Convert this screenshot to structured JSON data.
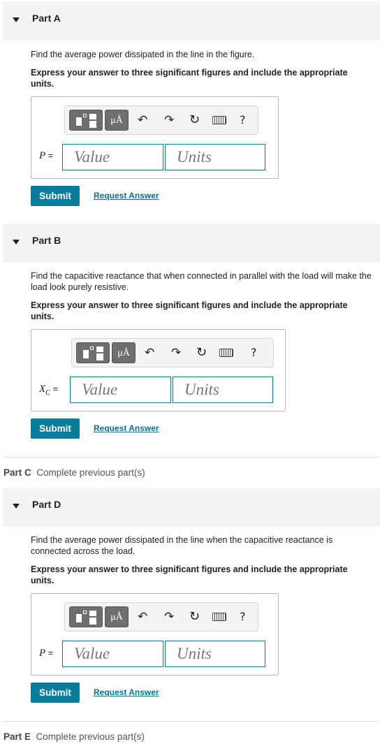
{
  "part_a": {
    "header": "Part A",
    "question": "Find the average power dissipated in the line in the figure.",
    "instruction": "Express your answer to three significant figures and include the appropriate units.",
    "variable": "P",
    "equals": "=",
    "value_placeholder": "Value",
    "units_placeholder": "Units",
    "submit": "Submit",
    "request": "Request Answer"
  },
  "part_b": {
    "header": "Part B",
    "question": "Find the capacitive reactance that when connected in parallel with the load will make the load look purely resistive.",
    "instruction": "Express your answer to three significant figures and include the appropriate units.",
    "variable": "X",
    "variable_sub": "C",
    "equals": "=",
    "value_placeholder": "Value",
    "units_placeholder": "Units",
    "submit": "Submit",
    "request": "Request Answer"
  },
  "part_c": {
    "label": "Part C",
    "status": "Complete previous part(s)"
  },
  "part_d": {
    "header": "Part D",
    "question": "Find the average power dissipated in the line when the capacitive reactance is connected across the load.",
    "instruction": "Express your answer to three significant figures and include the appropriate units.",
    "variable": "P",
    "equals": "=",
    "value_placeholder": "Value",
    "units_placeholder": "Units",
    "submit": "Submit",
    "request": "Request Answer"
  },
  "part_e": {
    "label": "Part E",
    "status": "Complete previous part(s)"
  },
  "toolbar": {
    "units_glyph": "μÅ",
    "undo_glyph": "↶",
    "redo_glyph": "↷",
    "reset_glyph": "↻",
    "help_glyph": "?"
  }
}
